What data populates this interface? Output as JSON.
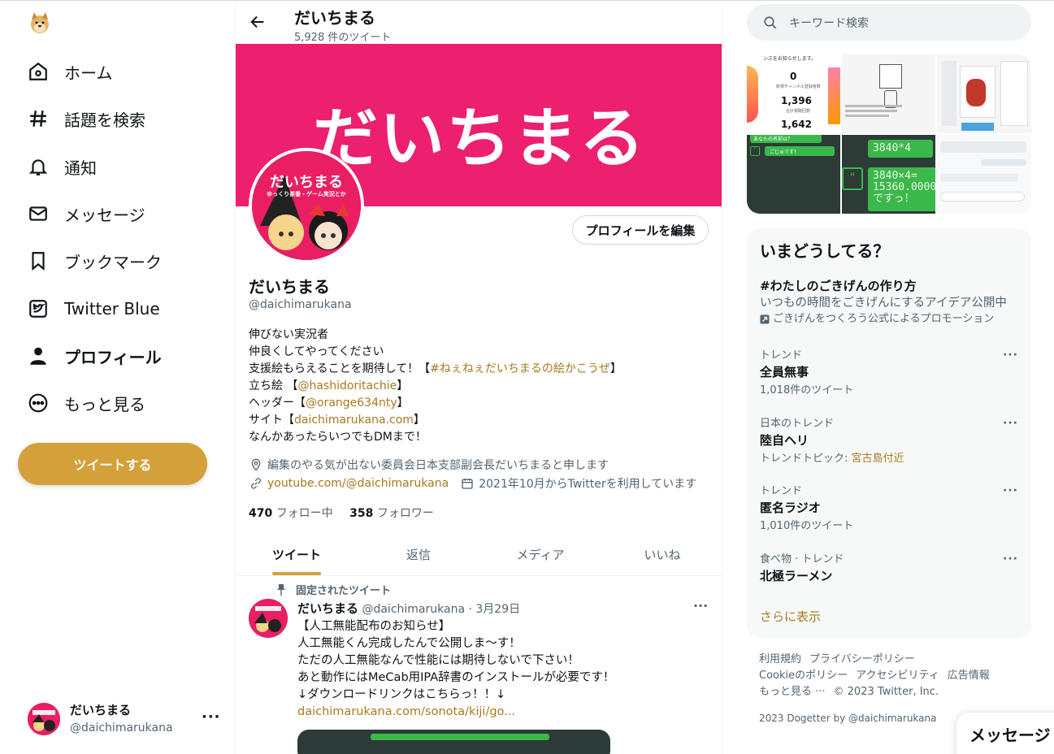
{
  "sidebar": {
    "nav": [
      {
        "label": "ホーム",
        "icon": "home-icon"
      },
      {
        "label": "話題を検索",
        "icon": "hashtag-icon"
      },
      {
        "label": "通知",
        "icon": "bell-icon"
      },
      {
        "label": "メッセージ",
        "icon": "mail-icon"
      },
      {
        "label": "ブックマーク",
        "icon": "bookmark-icon"
      },
      {
        "label": "Twitter Blue",
        "icon": "twitter-blue-icon"
      },
      {
        "label": "プロフィール",
        "icon": "person-icon"
      },
      {
        "label": "もっと見る",
        "icon": "more-circle-icon"
      }
    ],
    "tweet_button": "ツイートする",
    "account": {
      "name": "だいちまる",
      "handle": "@daichimarukana",
      "more": "···"
    }
  },
  "header": {
    "title": "だいちまる",
    "tweet_count": "5,928 件のツイート"
  },
  "banner": {
    "text": "だいちまる"
  },
  "avatar": {
    "line1": "だいちまる",
    "line2": "ゆっくり茶番・ゲーム実況とか"
  },
  "profile": {
    "edit_button": "プロフィールを編集",
    "name": "だいちまる",
    "handle": "@daichimarukana",
    "bio": {
      "l1": "伸びない実況者",
      "l2": "仲良くしてやってください",
      "l3_pre": "支援絵もらえることを期待して！【",
      "l3_link": "#ねぇねぇだいちまるの絵かこうぜ",
      "l3_post": "】",
      "l4_pre": "立ち絵 【",
      "l4_link": "@hashidoritachie",
      "l4_post": "】",
      "l5_pre": "ヘッダー【",
      "l5_link": "@orange634nty",
      "l5_post": "】",
      "l6_pre": "サイト【",
      "l6_link": "daichimarukana.com",
      "l6_post": "】",
      "l7": "なんかあったらいつでもDMまで！"
    },
    "location": "編集のやる気が出ない委員会日本支部副会長だいちまると申します",
    "website": "youtube.com/@daichimarukana",
    "joined": "2021年10月からTwitterを利用しています",
    "following_count": "470",
    "following_label": "フォロー中",
    "followers_count": "358",
    "followers_label": "フォロワー"
  },
  "tabs": [
    "ツイート",
    "返信",
    "メディア",
    "いいね"
  ],
  "pinned_tweet": {
    "pinned_label": "固定されたツイート",
    "name": "だいちまる",
    "handle": "@daichimarukana",
    "date": "· 3月29日",
    "more": "···",
    "lines": [
      "【人工無能配布のお知らせ】",
      "人工無能くん完成したんで公開しま～す！",
      "ただの人工無能なんで性能には期待しないで下さい！",
      "あと動作にはMeCab用IPA辞書のインストールが必要です！",
      "↓ダウンロードリンクはこちらっ！！↓"
    ],
    "link": "daichimarukana.com/sonota/kiji/go..."
  },
  "search": {
    "placeholder": "キーワード検索"
  },
  "media_preview": {
    "c1_header": "ンスをお知らせします。",
    "c1_n1": "0",
    "c1_l1": "新規チャンネル登録者数",
    "c1_n2": "1,396",
    "c1_l2": "合計視聴回数",
    "c1_n3": "1,642",
    "c4_q": "あなたの名前は？",
    "c4_a": "ごじゅです！",
    "c5_top": "3840*4",
    "c5_l1": "3840×4=",
    "c5_l2": "15360.000000",
    "c5_l3": "ですっ！"
  },
  "trends": {
    "title": "いまどうしてる？",
    "promo": {
      "tag": "#わたしのごきげんの作り方",
      "desc": "いつもの時間をごきげんにするアイデア公開中",
      "by": "ごきげんをつくろう公式によるプロモーション"
    },
    "items": [
      {
        "context": "トレンド",
        "name": "全員無事",
        "extra": "1,018件のツイート"
      },
      {
        "context": "日本のトレンド",
        "name": "陸自ヘリ",
        "extra_pre": "トレンドトピック: ",
        "extra_link": "宮古島付近"
      },
      {
        "context": "トレンド",
        "name": "匿名ラジオ",
        "extra": "1,010件のツイート"
      },
      {
        "context": "食べ物 · トレンド",
        "name": "北極ラーメン"
      }
    ],
    "dots": "···",
    "show_more": "さらに表示"
  },
  "footer": {
    "links": [
      "利用規約",
      "プライバシーポリシー",
      "Cookieのポリシー",
      "アクセシビリティ",
      "広告情報",
      "もっと見る ···",
      "© 2023 Twitter, Inc."
    ],
    "credit": "2023 Dogetter by @daichimarukana"
  },
  "message_drawer": {
    "label": "メッセージ"
  },
  "colors": {
    "accent": "#d4a03a",
    "link": "#a8791e",
    "banner": "#ed1f6f"
  }
}
